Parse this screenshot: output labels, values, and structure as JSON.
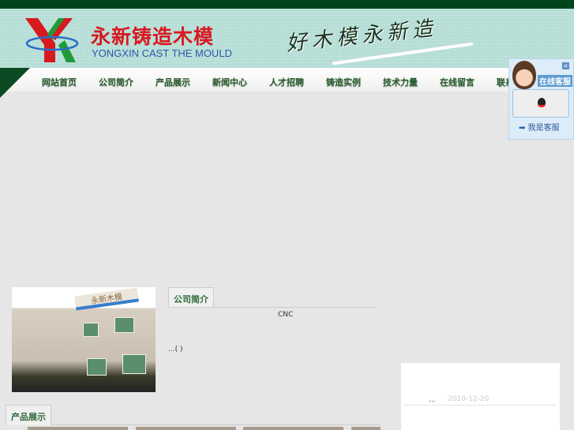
{
  "header": {
    "brand_cn": "永新铸造木模",
    "brand_en": "YONGXIN CAST THE MOULD",
    "slogan": "好木模永新造"
  },
  "nav": {
    "items": [
      "网站首页",
      "公司简介",
      "产品展示",
      "新闻中心",
      "人才招聘",
      "铸造实例",
      "技术力量",
      "在线留言",
      "联系"
    ]
  },
  "qq": {
    "title": "在线客服",
    "me": "我是客服",
    "close": "×"
  },
  "about": {
    "tab": "公司简介",
    "text1": "CNC",
    "text2": "...(      )"
  },
  "products": {
    "tab": "产品展示"
  },
  "news": {
    "ellipsis": "...",
    "date": "2010-12-20"
  },
  "photo_sign": "永新木模"
}
